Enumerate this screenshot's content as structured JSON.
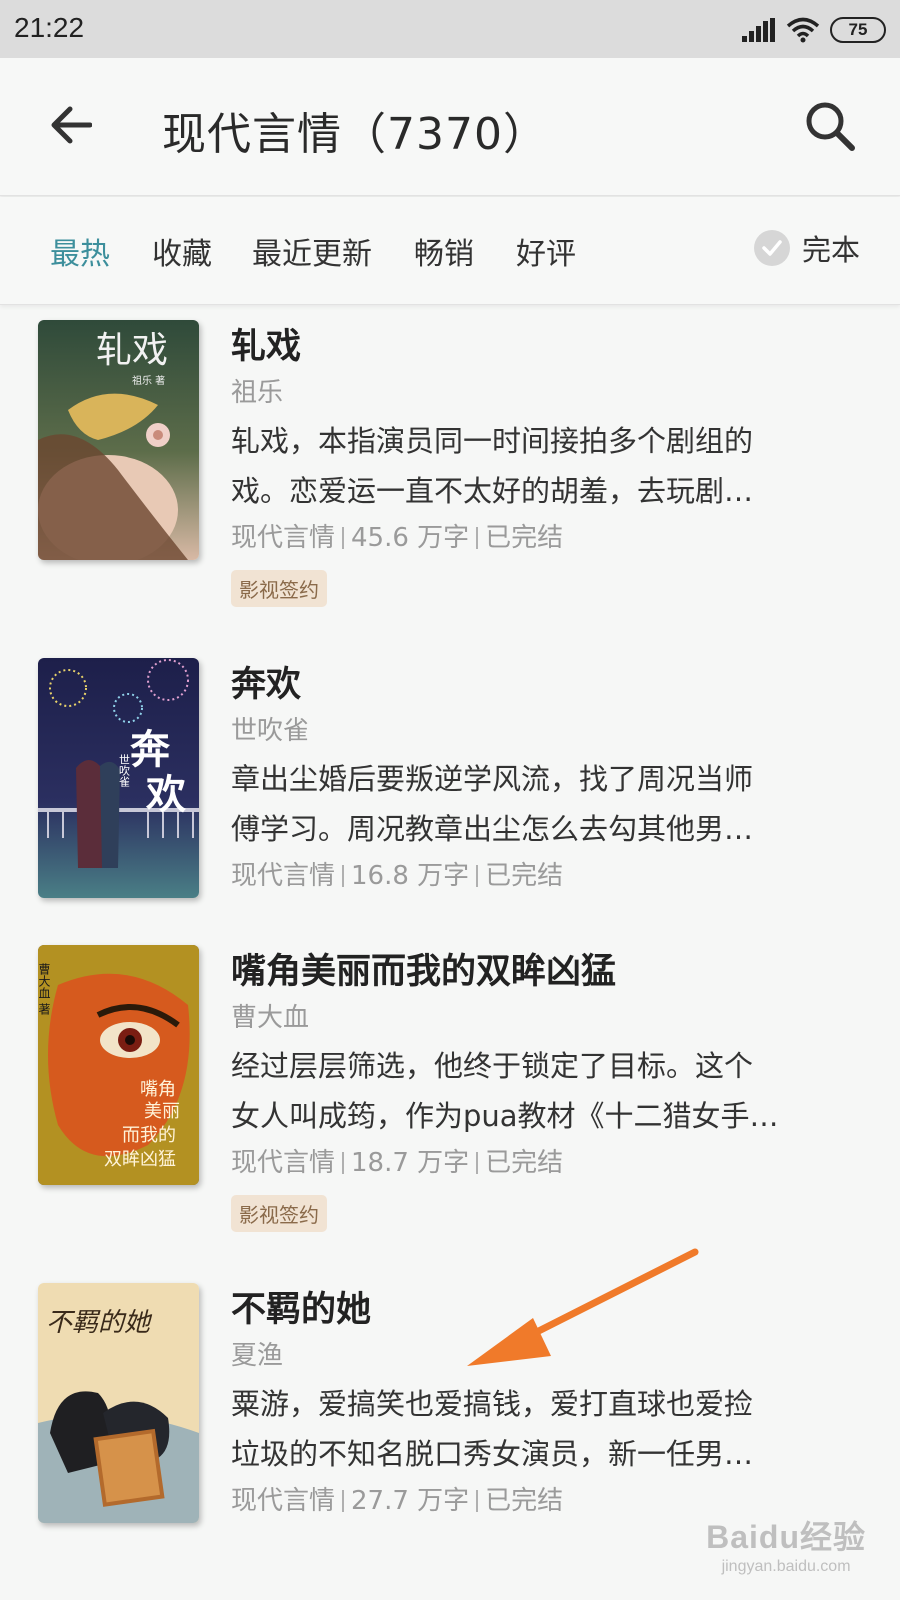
{
  "status": {
    "time": "21:22",
    "battery": "75"
  },
  "header": {
    "title": "现代言情（7370）"
  },
  "tabs": [
    {
      "label": "最热"
    },
    {
      "label": "收藏"
    },
    {
      "label": "最近更新"
    },
    {
      "label": "畅销"
    },
    {
      "label": "好评"
    }
  ],
  "filter": {
    "complete_label": "完本"
  },
  "books": [
    {
      "title": "轧戏",
      "author": "祖乐",
      "desc1": "轧戏，本指演员同一时间接拍多个剧组的",
      "desc2": "戏。恋爱运一直不太好的胡羞，去玩剧…",
      "category": "现代言情",
      "words": "45.6 万字",
      "status": "已完结",
      "tag": "影视签约",
      "cover_title": "轧戏",
      "cover_author": "祖乐 著"
    },
    {
      "title": "奔欢",
      "author": "世吹雀",
      "desc1": "章出尘婚后要叛逆学风流，找了周况当师",
      "desc2": "傅学习。周况教章出尘怎么去勾其他男…",
      "category": "现代言情",
      "words": "16.8 万字",
      "status": "已完结",
      "cover_title1": "奔",
      "cover_title2": "欢",
      "cover_author": "世吹雀"
    },
    {
      "title": "嘴角美丽而我的双眸凶猛",
      "author": "曹大血",
      "desc1": "经过层层筛选，他终于锁定了目标。这个",
      "desc2": "女人叫成筠，作为pua教材《十二猎女手…",
      "category": "现代言情",
      "words": "18.7 万字",
      "status": "已完结",
      "tag": "影视签约",
      "cover_author": "曹大血 著",
      "cover_lines": [
        "嘴角",
        "美丽",
        "而我的",
        "双眸凶猛"
      ]
    },
    {
      "title": "不羁的她",
      "author": "夏渔",
      "desc1": "粟游，爱搞笑也爱搞钱，爱打直球也爱捡",
      "desc2": "垃圾的不知名脱口秀女演员，新一任男…",
      "category": "现代言情",
      "words": "27.7 万字",
      "status": "已完结",
      "cover_title": "不羁的她"
    }
  ],
  "watermark": {
    "logo": "Baidu经验",
    "url": "jingyan.baidu.com"
  },
  "colors": {
    "accent": "#3d8f9c",
    "arrow": "#f07a2a",
    "tag_bg": "#f1e3d3"
  }
}
